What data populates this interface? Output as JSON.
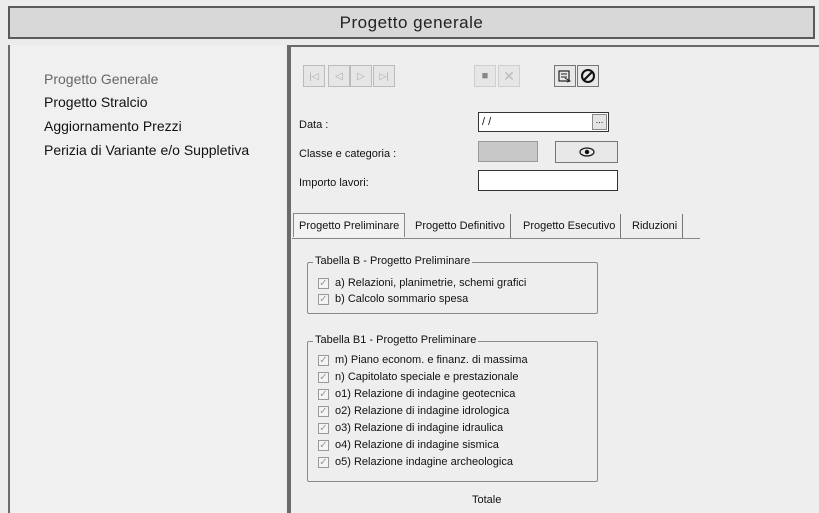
{
  "title": "Progetto generale",
  "nav": {
    "items": [
      {
        "label": "Progetto Generale"
      },
      {
        "label": "Progetto Stralcio"
      },
      {
        "label": "Aggiornamento Prezzi"
      },
      {
        "label": "Perizia di Variante e/o Suppletiva"
      }
    ]
  },
  "toolbar": {
    "first": "|◁",
    "prev": "◁",
    "next": "▷",
    "last": "▷|",
    "save": "■",
    "delete": "✕",
    "icons": {
      "first": "first-record-icon",
      "prev": "prev-record-icon",
      "next": "next-record-icon",
      "last": "last-record-icon",
      "save": "save-icon",
      "delete": "delete-icon",
      "print": "print-icon",
      "cancel": "cancel-icon"
    }
  },
  "form": {
    "data_label": "Data :",
    "data_value": " / /",
    "data_button": "...",
    "classe_label": "Classe e categoria :",
    "classe_view_icon": "eye-icon",
    "importo_label": "Importo lavori:",
    "importo_value": ""
  },
  "tabs": [
    {
      "label": "Progetto Preliminare"
    },
    {
      "label": "Progetto Definitivo"
    },
    {
      "label": "Progetto Esecutivo"
    },
    {
      "label": "Riduzioni"
    }
  ],
  "groupB": {
    "title": "Tabella B - Progetto Preliminare",
    "items": [
      {
        "label": "a) Relazioni, planimetrie, schemi grafici",
        "checked": true
      },
      {
        "label": "b) Calcolo sommario spesa",
        "checked": true
      }
    ]
  },
  "groupB1": {
    "title": "Tabella B1 - Progetto Preliminare",
    "items": [
      {
        "label": "m) Piano econom. e finanz. di massima",
        "checked": true
      },
      {
        "label": "n) Capitolato speciale e prestazionale",
        "checked": true
      },
      {
        "label": "o1) Relazione di indagine geotecnica",
        "checked": true
      },
      {
        "label": "o2) Relazione di indagine idrologica",
        "checked": true
      },
      {
        "label": "o3) Relazione di indagine idraulica",
        "checked": true
      },
      {
        "label": "o4) Relazione di indagine sismica",
        "checked": true
      },
      {
        "label": "o5) Relazione indagine archeologica",
        "checked": true
      }
    ]
  },
  "totale_label": "Totale"
}
